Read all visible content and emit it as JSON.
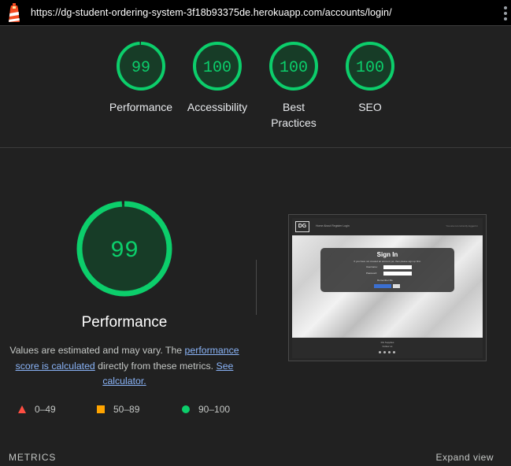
{
  "topbar": {
    "url": "https://dg-student-ordering-system-3f18b93375de.herokuapp.com/accounts/login/"
  },
  "gauges": [
    {
      "label": "Performance",
      "score": "99",
      "value": 0.99
    },
    {
      "label": "Accessibility",
      "score": "100",
      "value": 1.0
    },
    {
      "label": "Best Practices",
      "score": "100",
      "value": 1.0
    },
    {
      "label": "SEO",
      "score": "100",
      "value": 1.0
    }
  ],
  "performance": {
    "score": "99",
    "title": "Performance",
    "desc_1": "Values are estimated and may vary. The ",
    "link_1": "performance score is calculated",
    "desc_2": " directly from these metrics. ",
    "link_2": "See calculator."
  },
  "legend": [
    {
      "range": "0–49"
    },
    {
      "range": "50–89"
    },
    {
      "range": "90–100"
    }
  ],
  "thumbnail": {
    "logo": "DG",
    "nav_links": "Home   About   Register   Login",
    "nav_right": "You are not currently logged in",
    "card_title": "Sign In",
    "card_sub": "If you have not created an account yet, then please sign up first.",
    "username_label": "Username:",
    "password_label": "Password:",
    "remember_label": "Remember Me",
    "footer_line1": "DG Supplies",
    "footer_line2": "Follow us"
  },
  "footer": {
    "metrics_label": "METRICS",
    "expand_label": "Expand view"
  },
  "colors": {
    "pass": "#0cce6b",
    "pass_fill": "#0b3d24",
    "average": "#ffa400",
    "fail": "#ff4e42",
    "link": "#8ab4f8"
  }
}
